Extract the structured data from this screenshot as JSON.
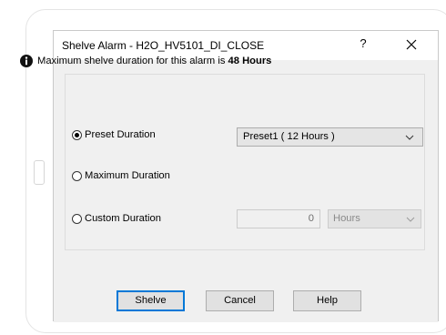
{
  "dialog": {
    "title": "Shelve Alarm - H2O_HV5101_DI_CLOSE",
    "help_glyph": "?",
    "close_glyph": "✕"
  },
  "info": {
    "text": "Maximum shelve duration for this alarm is ",
    "bold": "48 Hours",
    "icon": "info-icon"
  },
  "options": [
    {
      "label": "Preset Duration",
      "checked": true
    },
    {
      "label": "Maximum Duration",
      "checked": false
    },
    {
      "label": "Custom Duration",
      "checked": false
    }
  ],
  "preset_select": {
    "value": "Preset1 ( 12 Hours )"
  },
  "custom": {
    "value": "0",
    "units": "Hours",
    "enabled": false
  },
  "buttons": {
    "shelve": "Shelve",
    "cancel": "Cancel",
    "help": "Help"
  },
  "colors": {
    "focus_border": "#0078d7",
    "dialog_body": "#f0f0f0"
  }
}
